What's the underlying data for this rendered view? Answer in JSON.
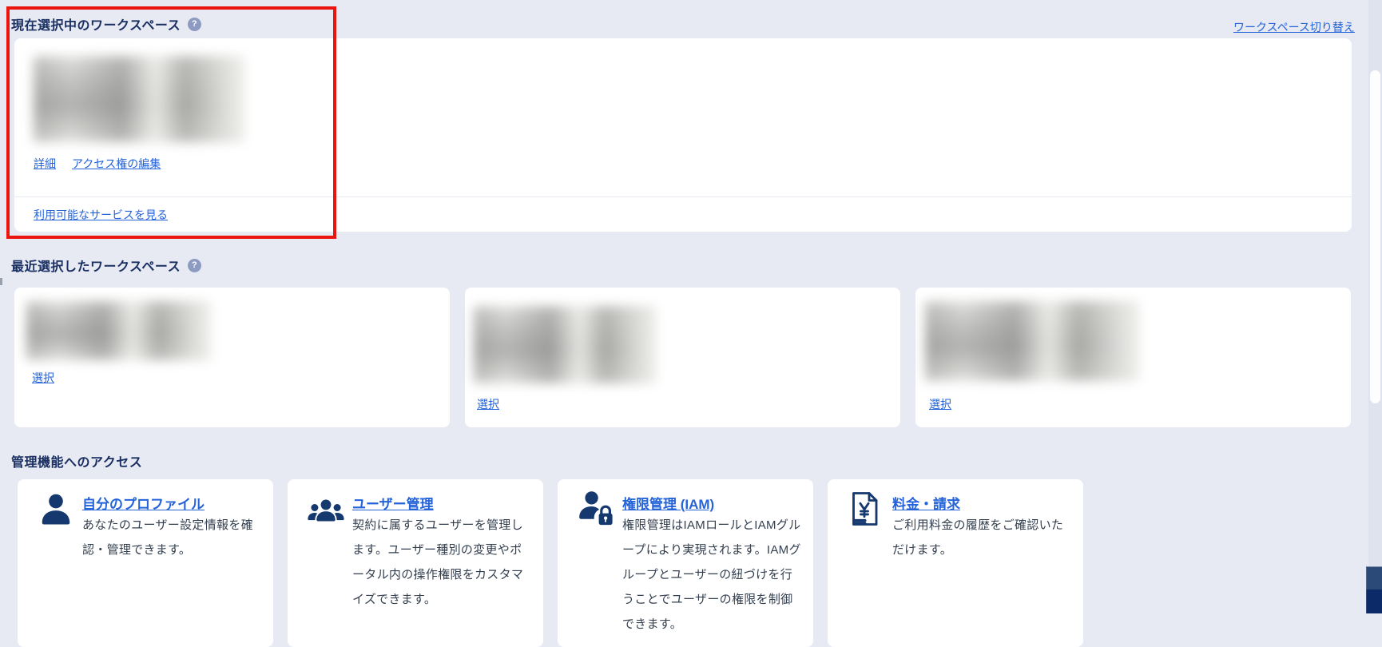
{
  "current_workspace": {
    "heading": "現在選択中のワークスペース",
    "help_icon_glyph": "?",
    "details_link": "詳細",
    "edit_access_link": "アクセス権の編集",
    "available_services_link": "利用可能なサービスを見る",
    "switch_workspace_link": "ワークスペース切り替え"
  },
  "recent_workspaces": {
    "heading": "最近選択したワークスペース",
    "help_icon_glyph": "?",
    "cards": [
      {
        "select_link": "選択"
      },
      {
        "select_link": "選択"
      },
      {
        "select_link": "選択"
      }
    ]
  },
  "admin_access": {
    "heading": "管理機能へのアクセス",
    "cards": [
      {
        "icon": "user-icon",
        "title": "自分のプロファイル",
        "description": "あなたのユーザー設定情報を確認・管理できます。"
      },
      {
        "icon": "users-icon",
        "title": "ユーザー管理",
        "description": "契約に属するユーザーを管理します。ユーザー種別の変更やポータル内の操作権限をカスタマイズできます。"
      },
      {
        "icon": "user-lock-icon",
        "title": "権限管理 (IAM)",
        "description": "権限管理はIAMロールとIAMグループにより実現されます。IAMグループとユーザーの紐づけを行うことでユーザーの権限を制御できます。"
      },
      {
        "icon": "yen-invoice-icon",
        "title": "料金・請求",
        "description": "ご利用料金の履歴をご確認いただけます。"
      }
    ]
  },
  "annotation": {
    "type": "red-highlight-box"
  },
  "colors": {
    "page_bg": "#e7eaf3",
    "accent_link": "#2563d9",
    "heading_navy": "#1a2f62",
    "icon_navy": "#15386e",
    "highlight_red": "#ea150f",
    "corner_button_top": "#2b4a78",
    "corner_button_bottom": "#0c2a67"
  }
}
